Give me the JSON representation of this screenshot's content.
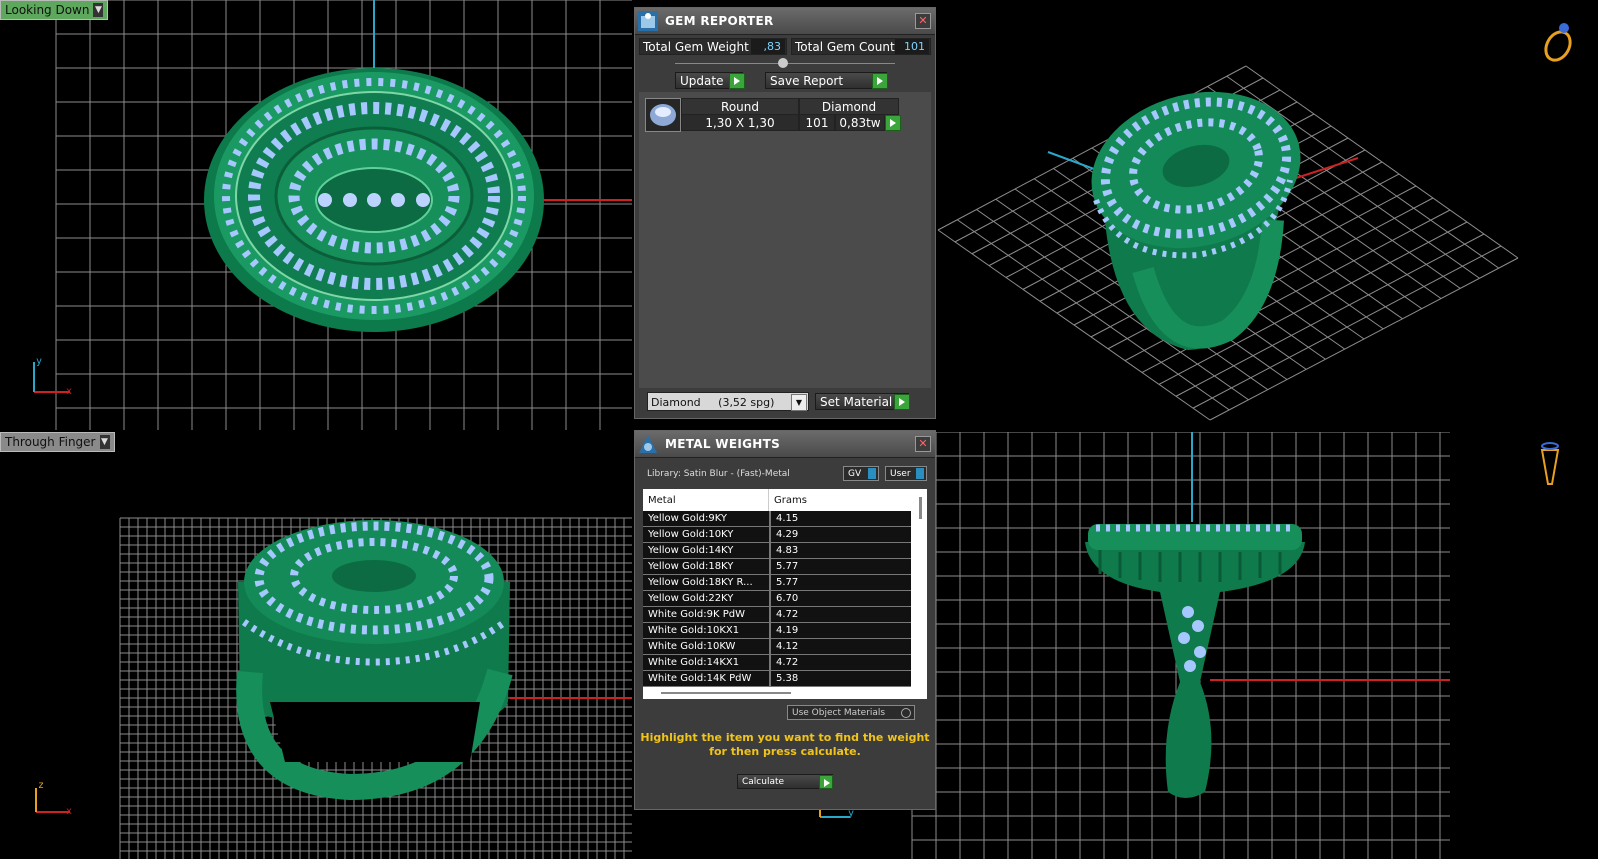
{
  "viewports": {
    "top_left": {
      "label": "Looking Down",
      "axis_v": "y",
      "axis_h": "x"
    },
    "bottom_left": {
      "label": "Through Finger",
      "axis_v": "z",
      "axis_h": "x"
    },
    "bottom_right": {
      "axis_v": "z",
      "axis_h": "y"
    }
  },
  "gem_reporter": {
    "title": "GEM REPORTER",
    "total_weight_label": "Total Gem Weight",
    "total_weight_value": ",83",
    "total_count_label": "Total Gem Count",
    "total_count_value": "101",
    "update_label": "Update",
    "save_report_label": "Save Report",
    "row": {
      "shape": "Round",
      "material": "Diamond",
      "size": "1,30 X 1,30",
      "count": "101",
      "weight": "0,83tw"
    },
    "material_select": "Diamond     (3,52 spg)",
    "set_material_label": "Set Material"
  },
  "metal_weights": {
    "title": "METAL WEIGHTS",
    "library": "Library: Satin Blur - (Fast)-Metal",
    "gv_label": "GV",
    "user_label": "User",
    "col_metal": "Metal",
    "col_grams": "Grams",
    "rows": [
      {
        "metal": "Yellow Gold:9KY",
        "grams": "4.15"
      },
      {
        "metal": "Yellow Gold:10KY",
        "grams": "4.29"
      },
      {
        "metal": "Yellow Gold:14KY",
        "grams": "4.83"
      },
      {
        "metal": "Yellow Gold:18KY",
        "grams": "5.77"
      },
      {
        "metal": "Yellow Gold:18KY R...",
        "grams": "5.77"
      },
      {
        "metal": "Yellow Gold:22KY",
        "grams": "6.70"
      },
      {
        "metal": "White Gold:9K PdW",
        "grams": "4.72"
      },
      {
        "metal": "White Gold:10KX1",
        "grams": "4.19"
      },
      {
        "metal": "White Gold:10KW",
        "grams": "4.12"
      },
      {
        "metal": "White Gold:14KX1",
        "grams": "4.72"
      },
      {
        "metal": "White Gold:14K PdW",
        "grams": "5.38"
      }
    ],
    "use_object_materials": "Use Object Materials",
    "hint_line1": "Highlight the item you want to find the weight",
    "hint_line2": "for then press calculate.",
    "calculate_label": "Calculate"
  },
  "colors": {
    "ring_green": "#1a8f5c",
    "gem_blue": "#8fb8ff",
    "grid": "#9a9a9a",
    "hint_yellow": "#f0c419"
  }
}
